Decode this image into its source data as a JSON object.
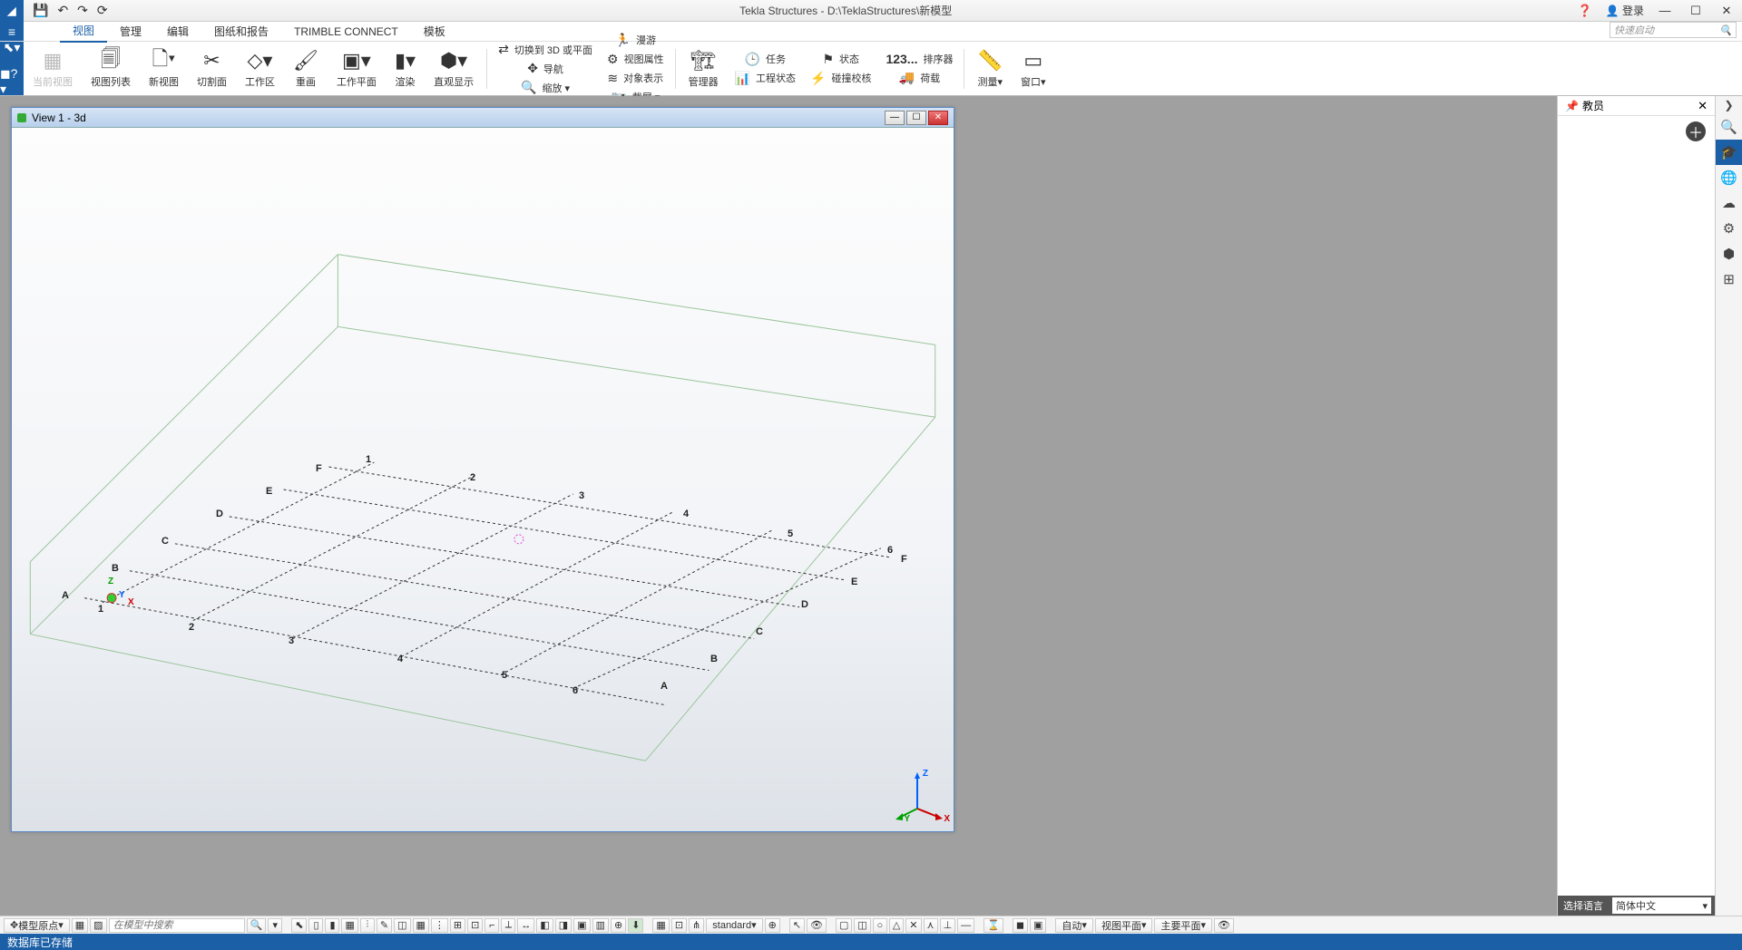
{
  "titlebar": {
    "title": "Tekla Structures - D:\\TeklaStructures\\新模型",
    "login": "登录"
  },
  "menu": {
    "tabs": [
      "视图",
      "管理",
      "编辑",
      "图纸和报告",
      "TRIMBLE CONNECT",
      "模板"
    ],
    "active": 0,
    "search_placeholder": "快速启动"
  },
  "ribbon": {
    "pointer": "▸",
    "current_view": "当前视图",
    "view_list": "视图列表",
    "new_view": "新视图",
    "clip_plane": "切割面",
    "work_area": "工作区",
    "redraw": "重画",
    "work_plane": "工作平面",
    "render": "渲染",
    "direct_display": "直观显示",
    "switch_3d": "切换到 3D 或平面",
    "nav": "导航",
    "zoom": "缩放",
    "roam": "漫游",
    "view_props": "视图属性",
    "object_rep": "对象表示",
    "screenshot": "截屏",
    "manager": "管理器",
    "task": "任务",
    "proj_status": "工程状态",
    "status": "状态",
    "clash": "碰撞校核",
    "sorter_num": "123...",
    "sorter": "排序器",
    "loads": "荷载",
    "measure": "测量",
    "window": "窗口"
  },
  "view": {
    "title": "View 1 - 3d",
    "grid_letters": [
      "A",
      "B",
      "C",
      "D",
      "E",
      "F"
    ],
    "grid_numbers": [
      "1",
      "2",
      "3",
      "4",
      "5",
      "6"
    ],
    "axes": {
      "x": "X",
      "y": "Y",
      "z": "Z"
    }
  },
  "sidepanel": {
    "title": "教员",
    "lang_label": "选择语言",
    "lang_value": "简体中文"
  },
  "bottombar": {
    "snap": "模型原点",
    "search_placeholder": "在模型中搜索",
    "standard": "standard",
    "auto": "自动",
    "view_plane": "视图平面",
    "main_plane": "主要平面"
  },
  "status": {
    "msg": "数据库已存储"
  }
}
